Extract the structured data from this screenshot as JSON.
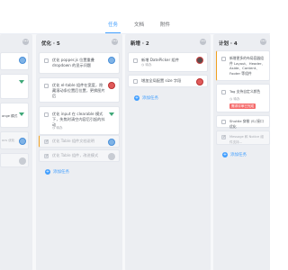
{
  "tabs": [
    {
      "label": "任务",
      "active": true
    },
    {
      "label": "文档",
      "active": false
    },
    {
      "label": "附件",
      "active": false
    }
  ],
  "columns": [
    {
      "title": "",
      "cards": [
        {
          "text": "",
          "meta": ""
        },
        {
          "text": "",
          "meta": ""
        },
        {
          "text": "ange 模式",
          "meta": ""
        },
        {
          "text": "ocs 优化",
          "meta": ""
        },
        {
          "text": "",
          "meta": ""
        }
      ],
      "add_label": "添加任务"
    },
    {
      "title": "优化 · 5",
      "cards": [
        {
          "text": "优化 popper.js 位置重叠 dropdown 的显示问题",
          "meta": "◷ 待办"
        },
        {
          "text": "优化 el-table 组件在宽度，隐藏滚动条位置后位置，更换图片后",
          "meta": "◷ 待办"
        },
        {
          "text": "优化 input 在 clearable 模式下，失焦时清空内容后引起的抖动",
          "meta": "◷ 待办"
        },
        {
          "text": "优化 Table 组件文档说明",
          "meta": ""
        },
        {
          "text": "优化 Table 组件，改进模式",
          "meta": ""
        }
      ],
      "add_label": "添加任务"
    },
    {
      "title": "新增 · 2",
      "cards": [
        {
          "text": "新增 DatePicker 组件",
          "meta": "◷ 待办"
        },
        {
          "text": "增加全局配置 size 字段",
          "meta": ""
        }
      ],
      "add_label": "添加任务"
    },
    {
      "title": "计划 · 4",
      "cards": [
        {
          "text": "新增更多的布局容器组件 Layout、Header、Aside、Content、Footer 等组件",
          "meta": "◷ 待办"
        },
        {
          "text": "Tag 支持自定义颜色",
          "meta": "◷ 待办",
          "badge": "需求评审已完成"
        },
        {
          "text": "Shuttle 穿梭 (S) 接口优化",
          "meta": ""
        },
        {
          "text": "Message 和 Notice 组件支持...",
          "meta": ""
        }
      ],
      "add_label": "添加任务"
    }
  ],
  "colors": {
    "accent": "#409eff",
    "board_bg": "#f7f8fa",
    "column_bg": "#eceef2"
  }
}
